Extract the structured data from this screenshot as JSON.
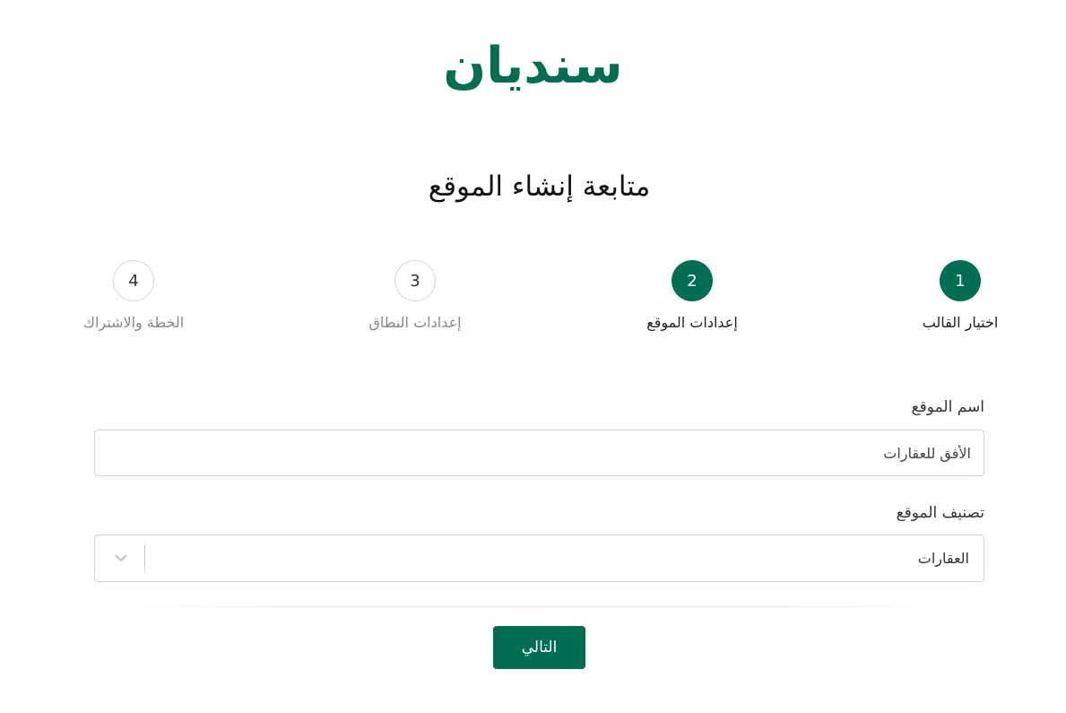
{
  "brand": {
    "logo_text": "سنديان",
    "color": "#006e51"
  },
  "page": {
    "title": "متابعة إنشاء الموقع"
  },
  "steps": [
    {
      "number": "1",
      "label": "اختيار القالب",
      "state": "active"
    },
    {
      "number": "2",
      "label": "إعدادات الموقع",
      "state": "active"
    },
    {
      "number": "3",
      "label": "إعدادات النطاق",
      "state": "inactive"
    },
    {
      "number": "4",
      "label": "الخطة والاشتراك",
      "state": "inactive"
    }
  ],
  "form": {
    "site_name_label": "اسم الموقع",
    "site_name_value": "الأفق للعقارات",
    "category_label": "تصنيف الموقع",
    "category_value": "العقارات",
    "category_icon": "chevron-down-icon"
  },
  "actions": {
    "next_label": "التالي"
  }
}
